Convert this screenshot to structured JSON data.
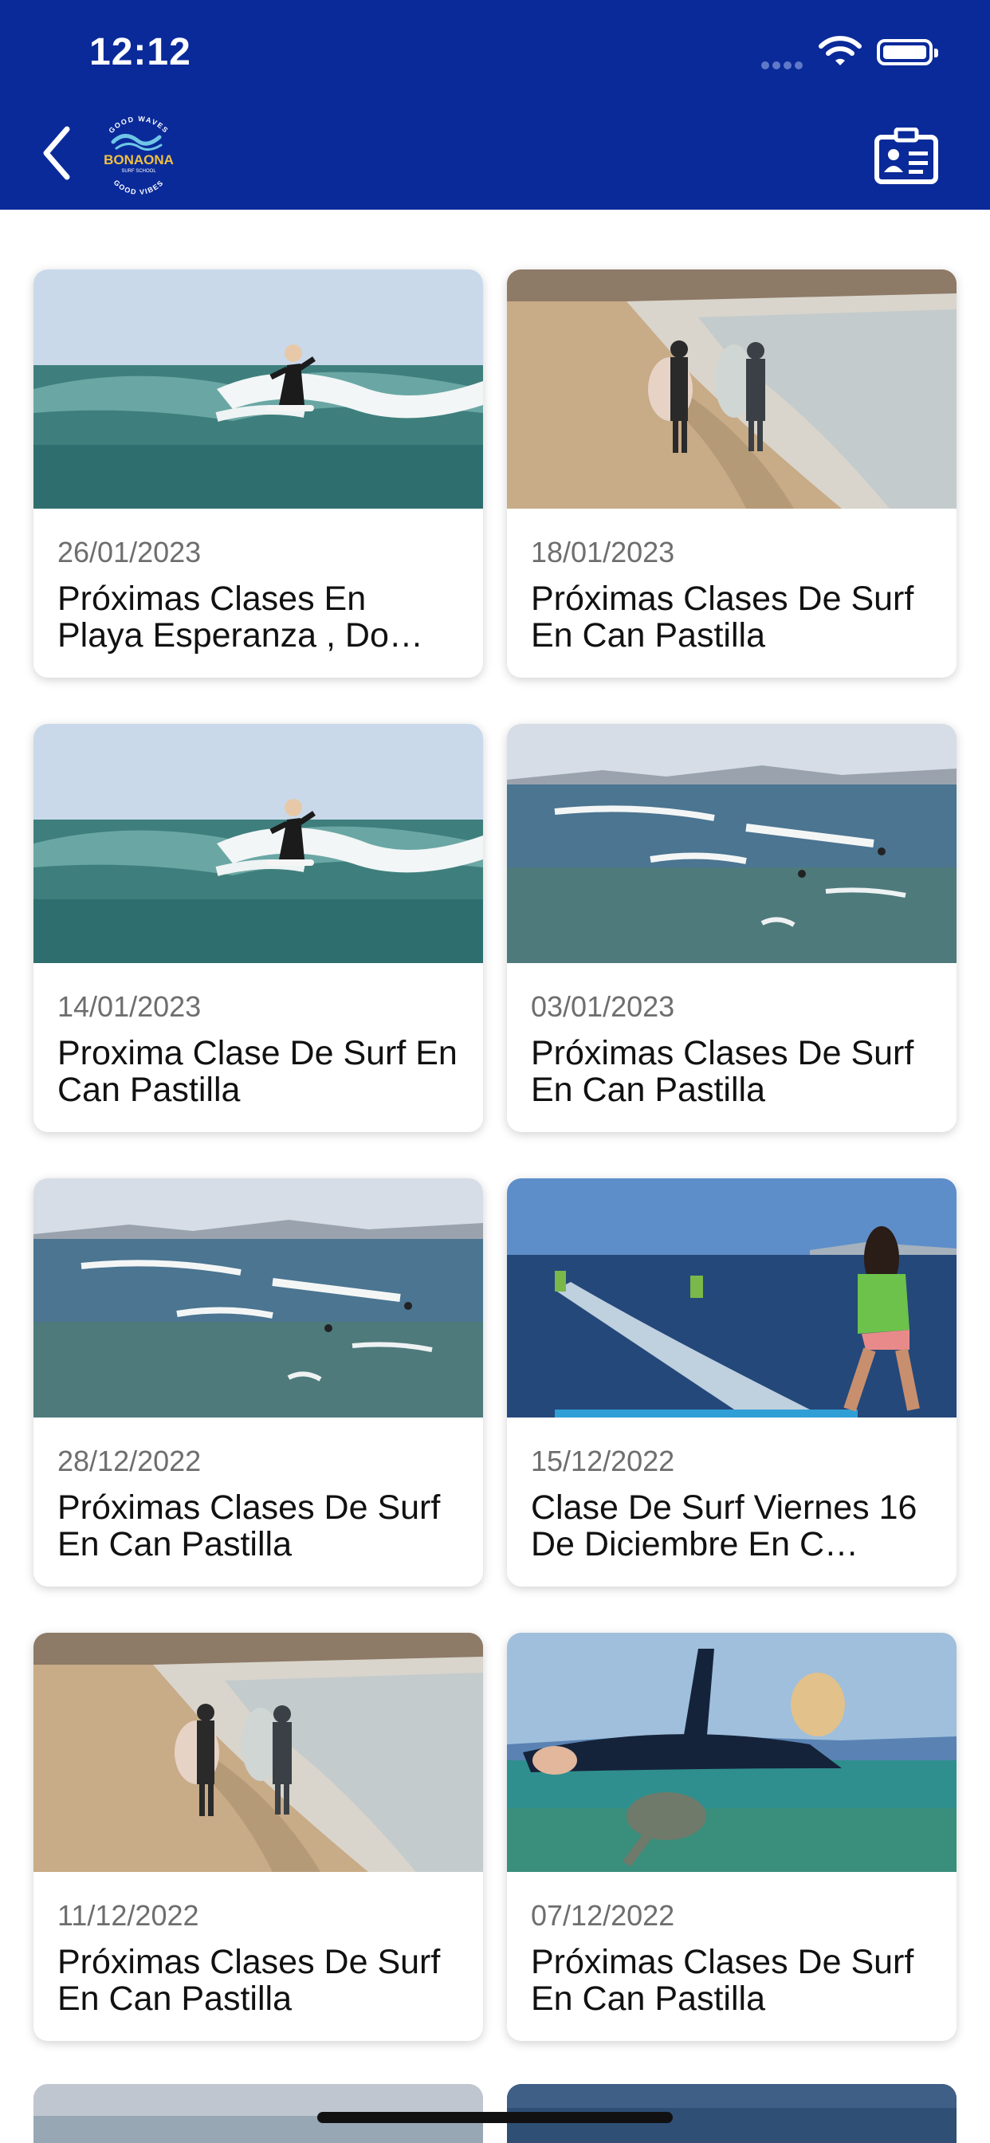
{
  "status_bar": {
    "time": "12:12"
  },
  "header": {
    "logo": {
      "brand": "BONAONA",
      "top_text": "GOOD WAVES",
      "bottom_text": "GOOD VIBES",
      "sub_text": "SURF SCHOOL"
    },
    "icons": [
      "back-icon",
      "profile-card-icon"
    ]
  },
  "posts": [
    {
      "date": "26/01/2023",
      "title": "Próximas Clases En Playa Esperanza , Do…",
      "image": "surfer-riding-wave"
    },
    {
      "date": "18/01/2023",
      "title": "Próximas Clases De Surf En Can Pastilla",
      "image": "surfers-walking-beach"
    },
    {
      "date": "14/01/2023",
      "title": "Proxima Clase De Surf En Can Pastilla",
      "image": "surfer-riding-wave"
    },
    {
      "date": "03/01/2023",
      "title": "Próximas Clases De Surf En Can Pastilla",
      "image": "waves-seascape"
    },
    {
      "date": "28/12/2022",
      "title": "Próximas Clases De Surf En Can Pastilla",
      "image": "waves-seascape"
    },
    {
      "date": "15/12/2022",
      "title": "Clase De Surf Viernes 16 De Diciembre En C…",
      "image": "surf-class-girl-green"
    },
    {
      "date": "11/12/2022",
      "title": "Próximas Clases De Surf En Can Pastilla",
      "image": "surfers-walking-beach"
    },
    {
      "date": "07/12/2022",
      "title": "Próximas Clases De Surf En Can Pastilla",
      "image": "surfer-underwater-turtle"
    }
  ],
  "colors": {
    "header_bg": "#0a2a9a",
    "card_bg": "#ffffff",
    "date_text": "#6e6e6e",
    "title_text": "#111111"
  }
}
